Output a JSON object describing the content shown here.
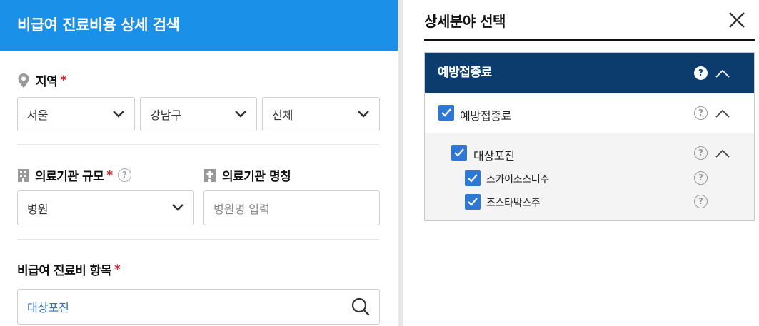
{
  "left": {
    "header_title": "비급여 진료비용 상세 검색",
    "region": {
      "label": "지역",
      "required_mark": "*",
      "city": "서울",
      "district": "강남구",
      "dong": "전체"
    },
    "hospital_scale": {
      "label": "의료기관 규모",
      "required_mark": "*",
      "help": "?",
      "value": "병원"
    },
    "hospital_name": {
      "label": "의료기관 명칭",
      "placeholder": "병원명 입력"
    },
    "item": {
      "label": "비급여 진료비 항목",
      "required_mark": "*",
      "value": "대상포진"
    }
  },
  "right": {
    "title": "상세분야 선택",
    "tree": {
      "header": "예방접종료",
      "header_help": "?",
      "level1": {
        "label": "예방접종료",
        "help": "?",
        "checked": true
      },
      "level2": {
        "label": "대상포진",
        "help": "?",
        "checked": true
      },
      "level3": [
        {
          "label": "스카이조스터주",
          "help": "?",
          "checked": true
        },
        {
          "label": "조스타박스주",
          "help": "?",
          "checked": true
        }
      ]
    }
  },
  "colors": {
    "header_blue": "#1a90e8",
    "tree_header_navy": "#0c3b6e",
    "checkbox_blue": "#2c78d4",
    "required_red": "#e0272d"
  }
}
